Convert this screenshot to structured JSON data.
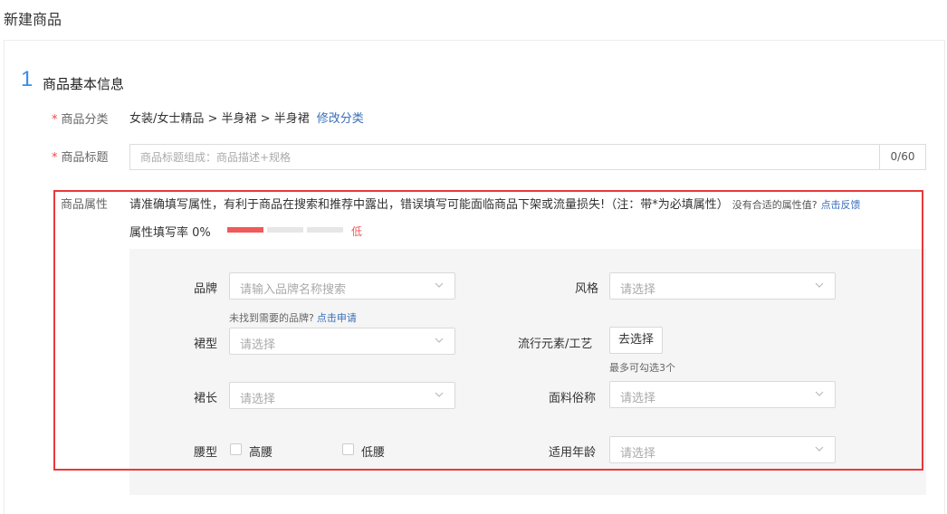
{
  "page": {
    "title": "新建商品"
  },
  "section": {
    "number": "1",
    "title": "商品基本信息"
  },
  "category": {
    "label": "商品分类",
    "value": "女装/女士精品 > 半身裙 > 半身裙",
    "edit_link": "修改分类"
  },
  "product_title": {
    "label": "商品标题",
    "placeholder": "商品标题组成：商品描述+规格",
    "value": "",
    "count": "0/60"
  },
  "attributes": {
    "label": "商品属性",
    "description": "请准确填写属性，有利于商品在搜索和推荐中露出，错误填写可能面临商品下架或流量损失!（注：带*为必填属性）",
    "no_match_text": "没有合适的属性值?",
    "feedback_link": "点击反馈",
    "fill_rate_text": "属性填写率 0%",
    "fill_level": "低",
    "fill_rate_fraction": 0.0,
    "fields": {
      "brand": {
        "label": "品牌",
        "placeholder": "请输入品牌名称搜索",
        "hint": "未找到需要的品牌?",
        "hint_link": "点击申请"
      },
      "style": {
        "label": "风格",
        "placeholder": "请选择"
      },
      "skirt_type": {
        "label": "裙型",
        "placeholder": "请选择"
      },
      "trend": {
        "label": "流行元素/工艺",
        "button": "去选择",
        "hint": "最多可勾选3个"
      },
      "skirt_length": {
        "label": "裙长",
        "placeholder": "请选择"
      },
      "fabric": {
        "label": "面料俗称",
        "placeholder": "请选择"
      },
      "waist": {
        "label": "腰型",
        "options": [
          "高腰",
          "低腰"
        ]
      },
      "age": {
        "label": "适用年龄",
        "placeholder": "请选择"
      }
    }
  },
  "colors": {
    "accent": "#3a8ee6",
    "required": "#e84a4a",
    "highlight": "#e8393a",
    "link": "#3a6fb8"
  }
}
